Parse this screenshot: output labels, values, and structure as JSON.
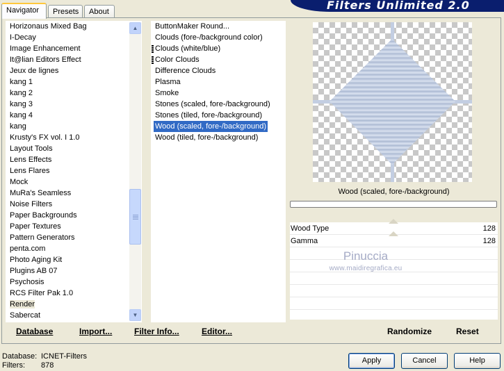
{
  "tabs": [
    {
      "label": "Navigator",
      "active": true
    },
    {
      "label": "Presets",
      "active": false
    },
    {
      "label": "About",
      "active": false
    }
  ],
  "banner_title": "Filters Unlimited 2.0",
  "categories": [
    "Horizonaus Mixed Bag",
    "I-Decay",
    "Image Enhancement",
    "It@lian Editors Effect",
    "Jeux de lignes",
    "kang 1",
    "kang 2",
    "kang 3",
    "kang 4",
    "kang",
    "Krusty's FX vol. I 1.0",
    "Layout Tools",
    "Lens Effects",
    "Lens Flares",
    "Mock",
    "MuRa's Seamless",
    "Noise Filters",
    "Paper Backgrounds",
    "Paper Textures",
    "Pattern Generators",
    "penta.com",
    "Photo Aging Kit",
    "Plugins AB 07",
    "Psychosis",
    "RCS Filter Pak 1.0",
    "Render",
    "Sabercat"
  ],
  "selected_category": "Render",
  "filters": [
    {
      "label": "ButtonMaker Round...",
      "marker": false
    },
    {
      "label": "Clouds (fore-/background color)",
      "marker": false
    },
    {
      "label": "Clouds (white/blue)",
      "marker": true
    },
    {
      "label": "Color Clouds",
      "marker": true
    },
    {
      "label": "Difference Clouds",
      "marker": false
    },
    {
      "label": "Plasma",
      "marker": false
    },
    {
      "label": "Smoke",
      "marker": false
    },
    {
      "label": "Stones (scaled, fore-/background)",
      "marker": false
    },
    {
      "label": "Stones (tiled, fore-/background)",
      "marker": false
    },
    {
      "label": "Wood (scaled, fore-/background)",
      "marker": false
    },
    {
      "label": "Wood (tiled, fore-/background)",
      "marker": false
    }
  ],
  "selected_filter": "Wood (scaled, fore-/background)",
  "preview_filter_name": "Wood (scaled, fore-/background)",
  "params": [
    {
      "label": "Wood Type",
      "value": "128"
    },
    {
      "label": "Gamma",
      "value": "128"
    }
  ],
  "watermark": {
    "title": "Pinuccia",
    "subtitle": "www.maidiregrafica.eu"
  },
  "links": [
    "Database",
    "Import...",
    "Filter Info...",
    "Editor..."
  ],
  "actions": [
    "Randomize",
    "Reset"
  ],
  "status": {
    "database_label": "Database:",
    "database_value": "ICNET-Filters",
    "filters_label": "Filters:",
    "filters_value": "878"
  },
  "buttons": {
    "apply": "Apply",
    "cancel": "Cancel",
    "help": "Help"
  },
  "colors": {
    "selection": "#316ac5",
    "banner": "#0a1e6e",
    "wood": "#c0cbe0"
  }
}
